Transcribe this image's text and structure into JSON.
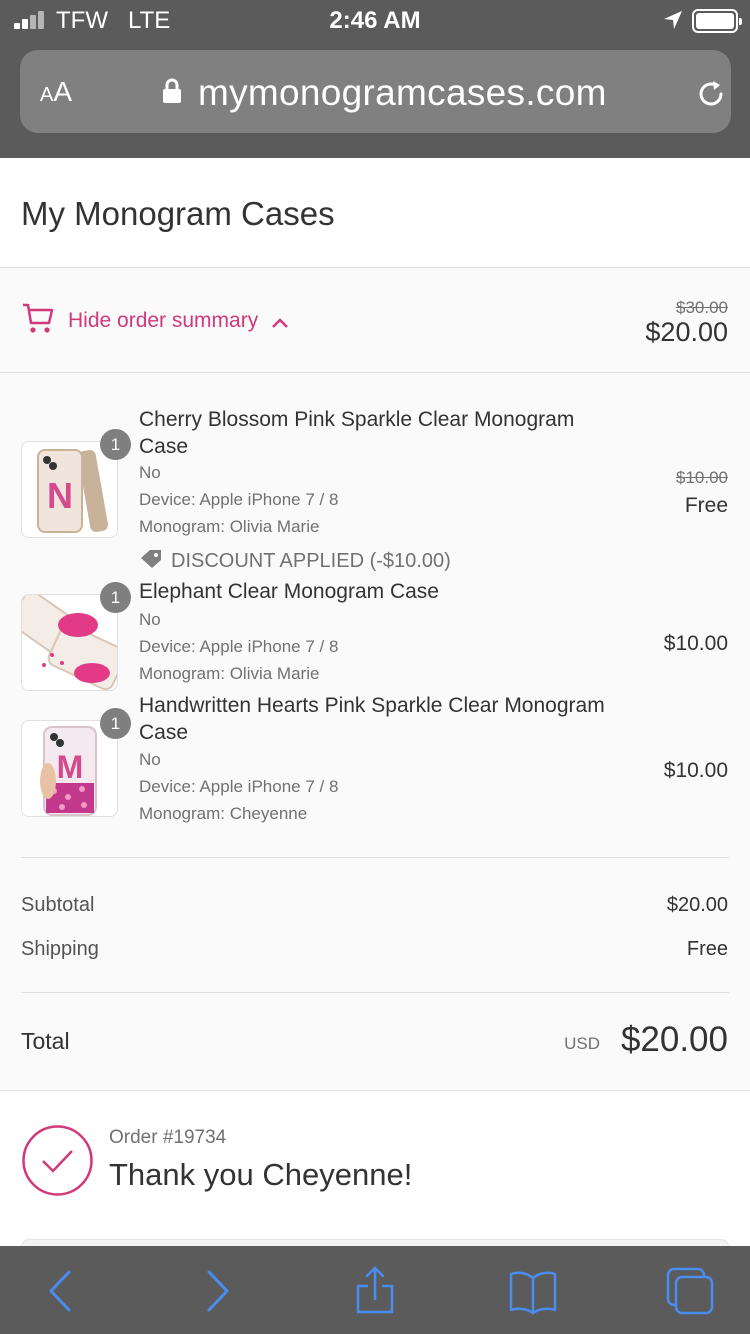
{
  "status_bar": {
    "carrier": "TFW",
    "network": "LTE",
    "time": "2:46 AM"
  },
  "browser": {
    "text_size_label_small": "A",
    "text_size_label_large": "A",
    "url": "mymonogramcases.com"
  },
  "header": {
    "store_name": "My Monogram Cases"
  },
  "summary_toggle": {
    "label": "Hide order summary",
    "original_total": "$30.00",
    "total": "$20.00"
  },
  "items": [
    {
      "quantity": "1",
      "name": "Cherry Blossom Pink Sparkle Clear Monogram Case",
      "option": "No",
      "device": "Device: Apple iPhone 7 / 8",
      "monogram": "Monogram: Olivia Marie",
      "original_price": "$10.00",
      "price": "Free",
      "discount": "DISCOUNT APPLIED (-$10.00)",
      "thumb_letter": "N"
    },
    {
      "quantity": "1",
      "name": "Elephant Clear Monogram Case",
      "option": "No",
      "device": "Device: Apple iPhone 7 / 8",
      "monogram": "Monogram: Olivia Marie",
      "price": "$10.00"
    },
    {
      "quantity": "1",
      "name": "Handwritten Hearts Pink Sparkle Clear Monogram Case",
      "option": "No",
      "device": "Device: Apple iPhone 7 / 8",
      "monogram": "Monogram: Cheyenne",
      "price": "$10.00",
      "thumb_letter": "M"
    }
  ],
  "totals": {
    "subtotal_label": "Subtotal",
    "subtotal": "$20.00",
    "shipping_label": "Shipping",
    "shipping": "Free",
    "total_label": "Total",
    "currency": "USD",
    "total": "$20.00"
  },
  "confirmation": {
    "order_number": "Order #19734",
    "message": "Thank you Cheyenne!"
  },
  "colors": {
    "accent": "#d1397b",
    "chrome": "#5b5b5b",
    "ios_blue": "#4a8df0"
  }
}
